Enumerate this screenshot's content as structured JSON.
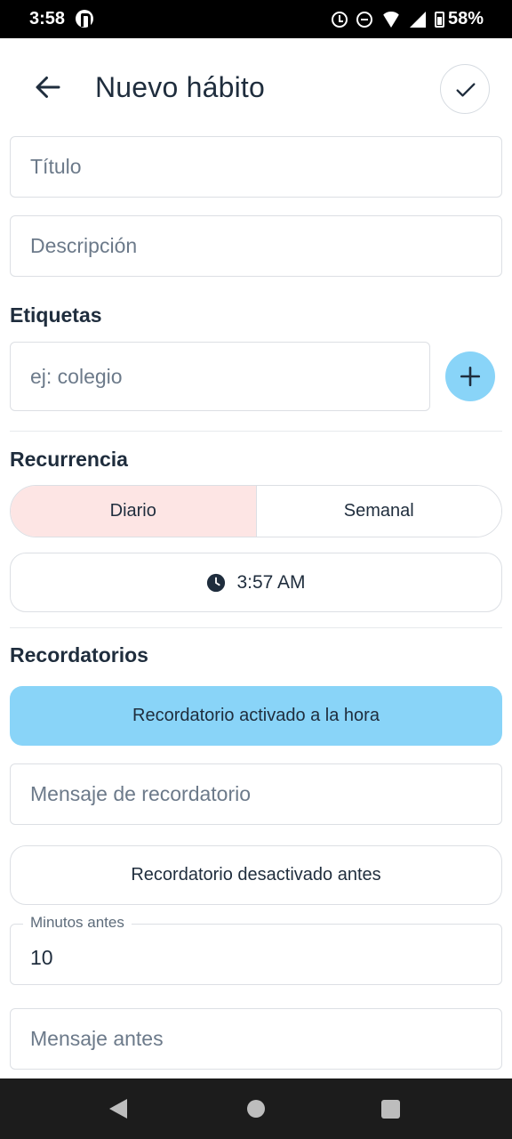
{
  "status_bar": {
    "time": "3:58",
    "battery": "58%"
  },
  "header": {
    "title": "Nuevo hábito"
  },
  "form": {
    "title_placeholder": "Título",
    "description_placeholder": "Descripción",
    "tags_heading": "Etiquetas",
    "tag_placeholder": "ej: colegio",
    "recurrence_heading": "Recurrencia",
    "recurrence_options": [
      "Diario",
      "Semanal"
    ],
    "selected_recurrence": "Diario",
    "time": "3:57 AM",
    "reminders_heading": "Recordatorios",
    "reminder_on_label": "Recordatorio activado a la hora",
    "reminder_message_placeholder": "Mensaje de recordatorio",
    "reminder_before_label": "Recordatorio desactivado antes",
    "minutes_before_label": "Minutos antes",
    "minutes_before_value": "10",
    "message_before_placeholder": "Mensaje antes"
  },
  "colors": {
    "accent": "#89d4f8",
    "selected_segment": "#fde5e4",
    "text": "#1f2d3d"
  }
}
